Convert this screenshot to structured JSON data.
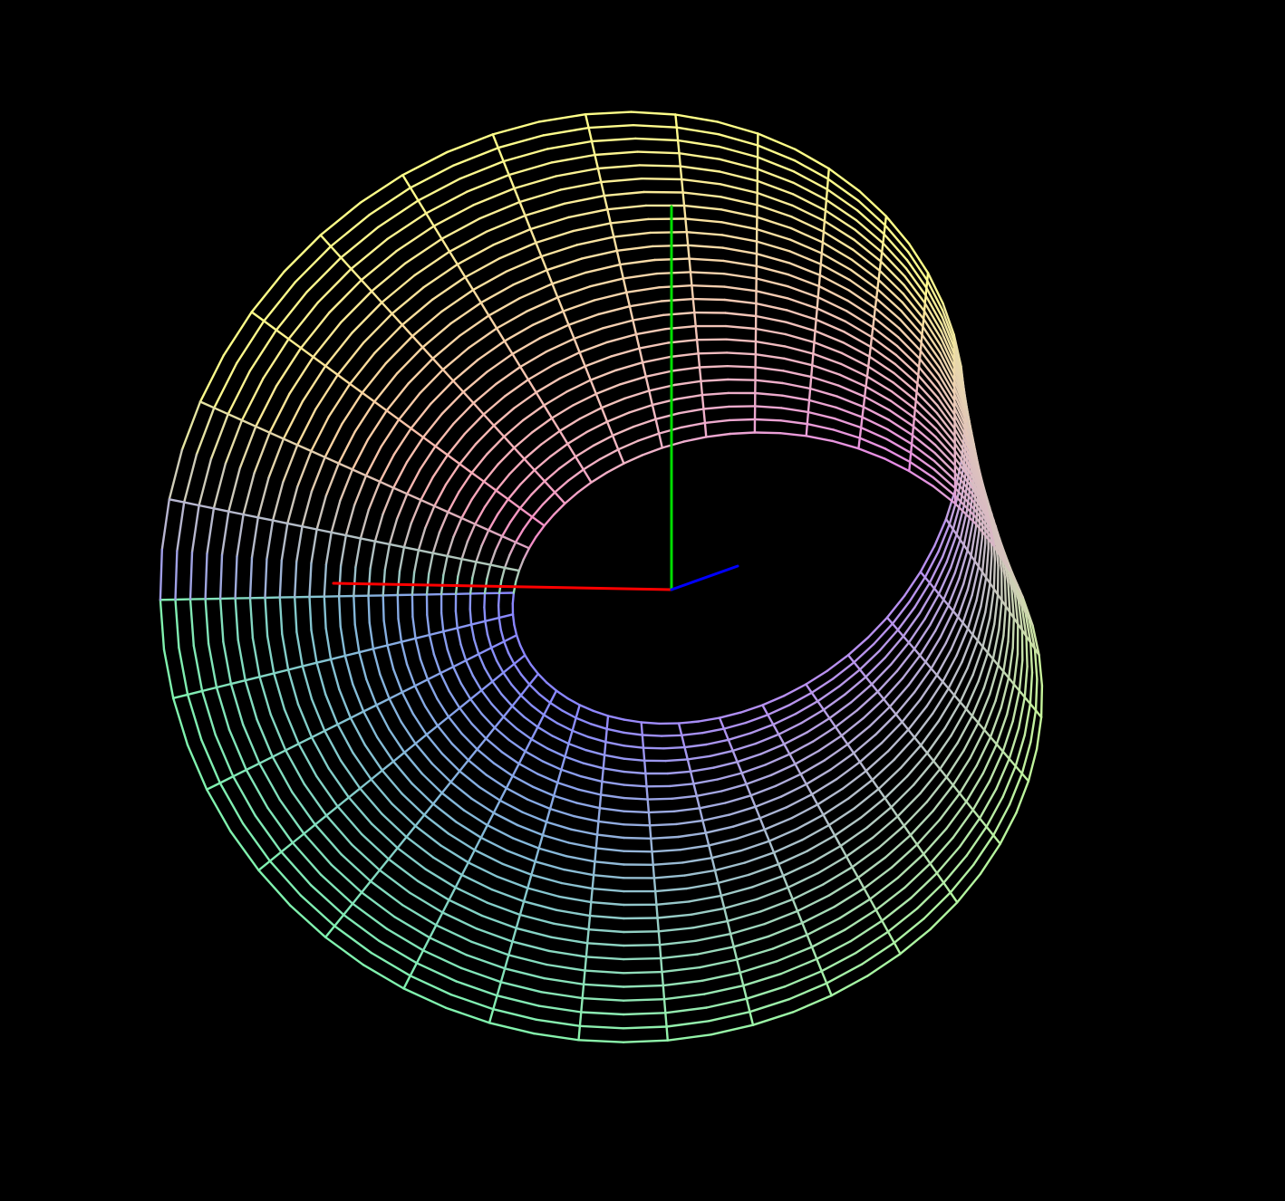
{
  "scene": {
    "background": "#000000",
    "surface": "mobius-strip-wireframe",
    "render_mode": "wireframe",
    "mesh": {
      "u_segments": 64,
      "v_segments": 24
    },
    "colors": {
      "top_left": "#80f2ae",
      "top_inner": "#8a86ff",
      "top_right": "#aef5a0",
      "top_right_inner": "#b890f0",
      "right_twist": "#c8f49a",
      "bottom_left": "#f58ac7",
      "bottom_inner": "#ffff88",
      "bottom_right": "#e58ae5",
      "bottom_center": "#f0b6c5"
    },
    "axes": {
      "x_axis_color": "#ff0000",
      "y_axis_color": "#00dd00",
      "z_axis_color": "#0000ff"
    }
  }
}
